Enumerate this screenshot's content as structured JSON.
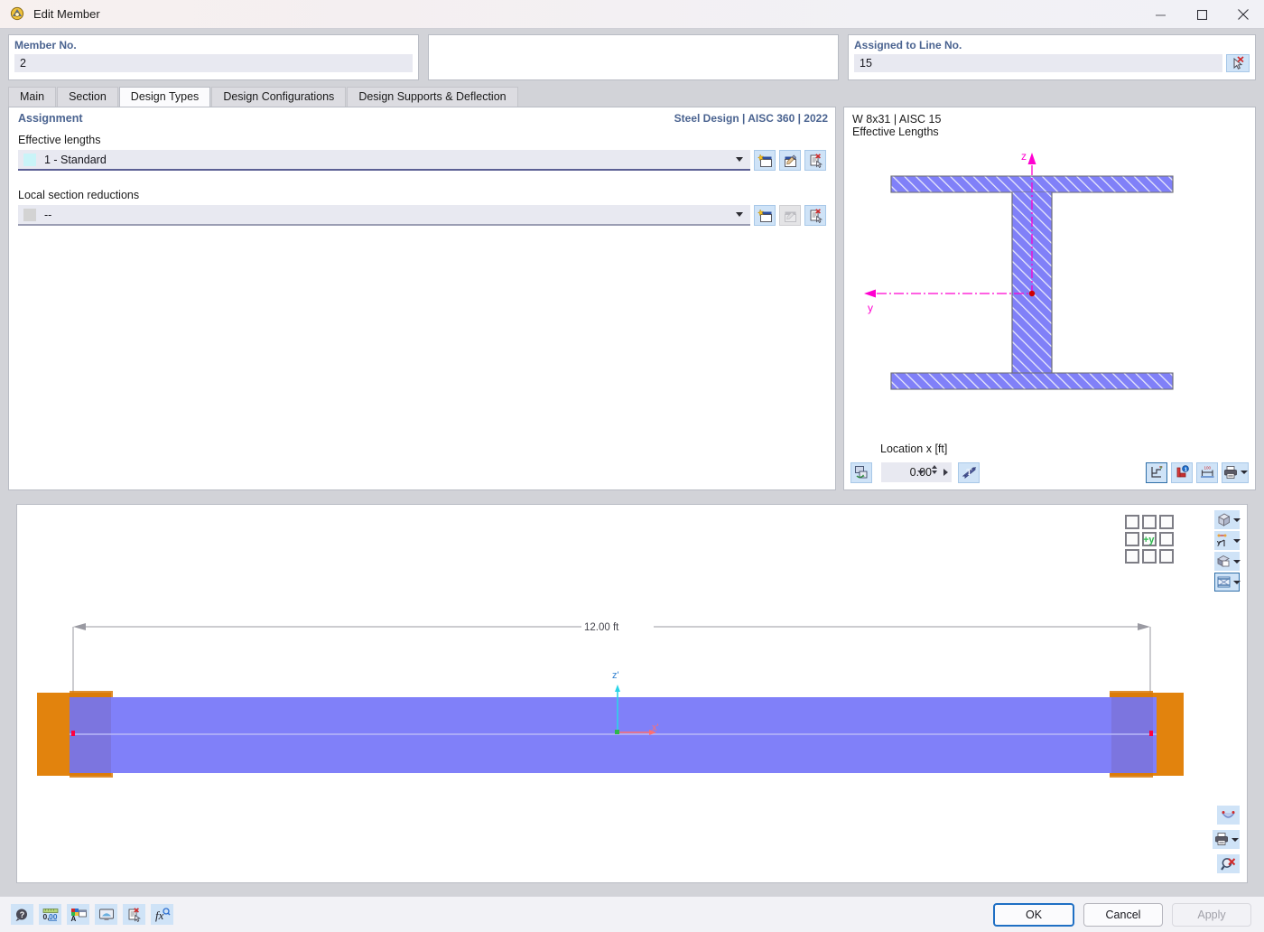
{
  "window": {
    "title": "Edit Member",
    "icon": "member-icon",
    "minimize": "—",
    "maximize": "□",
    "close": "✕"
  },
  "header": {
    "member": {
      "label": "Member No.",
      "value": "2"
    },
    "blank": {
      "label": "",
      "value": ""
    },
    "line": {
      "label": "Assigned to Line No.",
      "value": "15",
      "pick_icon": "select-line-icon"
    }
  },
  "tabs": [
    {
      "label": "Main",
      "active": false
    },
    {
      "label": "Section",
      "active": false
    },
    {
      "label": "Design Types",
      "active": true
    },
    {
      "label": "Design Configurations",
      "active": false
    },
    {
      "label": "Design Supports & Deflection",
      "active": false
    }
  ],
  "assignment": {
    "title": "Assignment",
    "standard": "Steel Design | AISC 360 | 2022",
    "effective_lengths": {
      "label": "Effective lengths",
      "value": "1 - Standard",
      "swatch_color": "#c9f4f8",
      "buttons": [
        "new-icon",
        "edit-icon",
        "delete-icon"
      ]
    },
    "local_section_reductions": {
      "label": "Local section reductions",
      "value": "--",
      "swatch_color": "#d3d3d3",
      "buttons": [
        "new-icon",
        "edit-icon-disabled",
        "delete-icon"
      ]
    }
  },
  "section_preview": {
    "line1": "W 8x31 | AISC 15",
    "line2": "Effective Lengths",
    "axis_z": "z",
    "axis_y": "y",
    "location_label": "Location x [ft]",
    "location_value": "0.00",
    "left_button": "render-mode-icon",
    "after_spin_button": "section-properties-icon",
    "right_buttons": [
      "coordinate-system-icon",
      "info-icon",
      "dimensions-icon",
      "print-icon"
    ]
  },
  "viewport": {
    "dimension_label": "12.00 ft",
    "axis_z": "z'",
    "axis_x": "x'",
    "viewcube_label": "+y",
    "beam_color": "#8080f8",
    "support_color": "#e2830d",
    "top_buttons": [
      "view-cube-icon",
      "axis-system-icon",
      "render-solid-icon",
      "deformation-icon"
    ],
    "bottom_buttons": [
      "results-curve-icon",
      "print-icon",
      "zoom-reset-icon"
    ]
  },
  "footer": {
    "tools": [
      "help-icon",
      "numeric-format-icon",
      "display-properties-icon",
      "graphic-settings-icon",
      "delete-icon",
      "function-icon"
    ],
    "ok": "OK",
    "cancel": "Cancel",
    "apply": "Apply"
  }
}
